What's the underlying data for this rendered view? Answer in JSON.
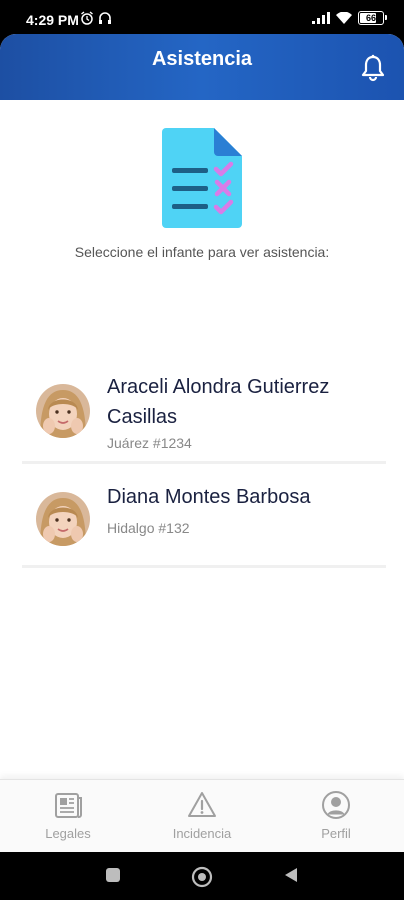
{
  "status_bar": {
    "time": "4:29 PM",
    "battery_level": "66"
  },
  "header": {
    "title": "Asistencia"
  },
  "prompt_text": "Seleccione el infante para ver asistencia:",
  "children": [
    {
      "name": "Araceli Alondra Gutierrez Casillas",
      "address": "Juárez #1234"
    },
    {
      "name": "Diana Montes Barbosa",
      "address": "Hidalgo #132"
    }
  ],
  "bottom_nav": {
    "items": [
      {
        "label": "Legales",
        "icon": "document-icon"
      },
      {
        "label": "Incidencia",
        "icon": "warning-icon"
      },
      {
        "label": "Perfil",
        "icon": "user-icon"
      }
    ]
  },
  "colors": {
    "header_start": "#1d4fa3",
    "header_end": "#2466c5",
    "text_primary": "#1a2140",
    "text_muted": "#888888",
    "nav_inactive": "#a0a0a0",
    "illustration_blue": "#4fd3f5",
    "illustration_check": "#d87ce8"
  }
}
